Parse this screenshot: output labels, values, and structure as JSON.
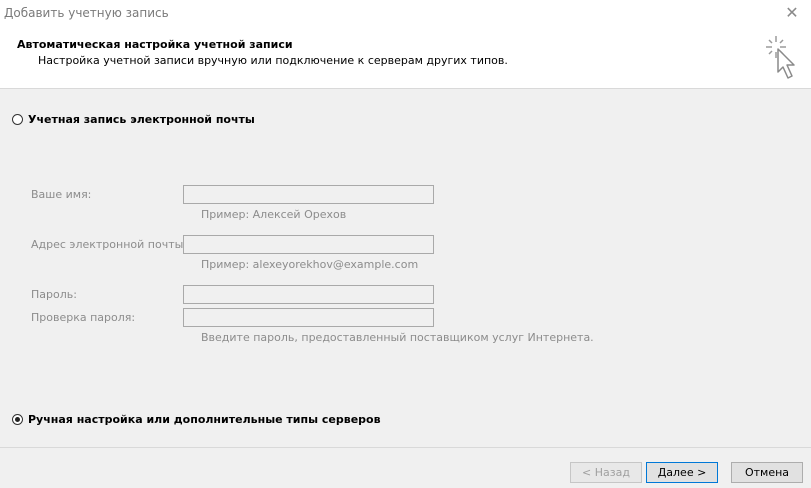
{
  "window": {
    "title": "Добавить учетную запись",
    "close_glyph": "✕"
  },
  "header": {
    "title": "Автоматическая настройка учетной записи",
    "subtitle": "Настройка учетной записи вручную или подключение к серверам других типов.",
    "icon": "wizard-cursor-icon"
  },
  "options": {
    "email_account": {
      "label": "Учетная запись электронной почты",
      "selected": false
    },
    "manual": {
      "label": "Ручная настройка или дополнительные типы серверов",
      "selected": true
    }
  },
  "form": {
    "name": {
      "label": "Ваше имя:",
      "value": "",
      "hint": "Пример: Алексей Орехов"
    },
    "email": {
      "label": "Адрес электронной почты:",
      "value": "",
      "hint": "Пример: alexeyorekhov@example.com"
    },
    "password": {
      "label": "Пароль:",
      "value": ""
    },
    "password_confirm": {
      "label": "Проверка пароля:",
      "value": "",
      "hint": "Введите пароль, предоставленный поставщиком услуг Интернета."
    }
  },
  "buttons": {
    "back": "< Назад",
    "next": "Далее >",
    "cancel": "Отмена"
  }
}
